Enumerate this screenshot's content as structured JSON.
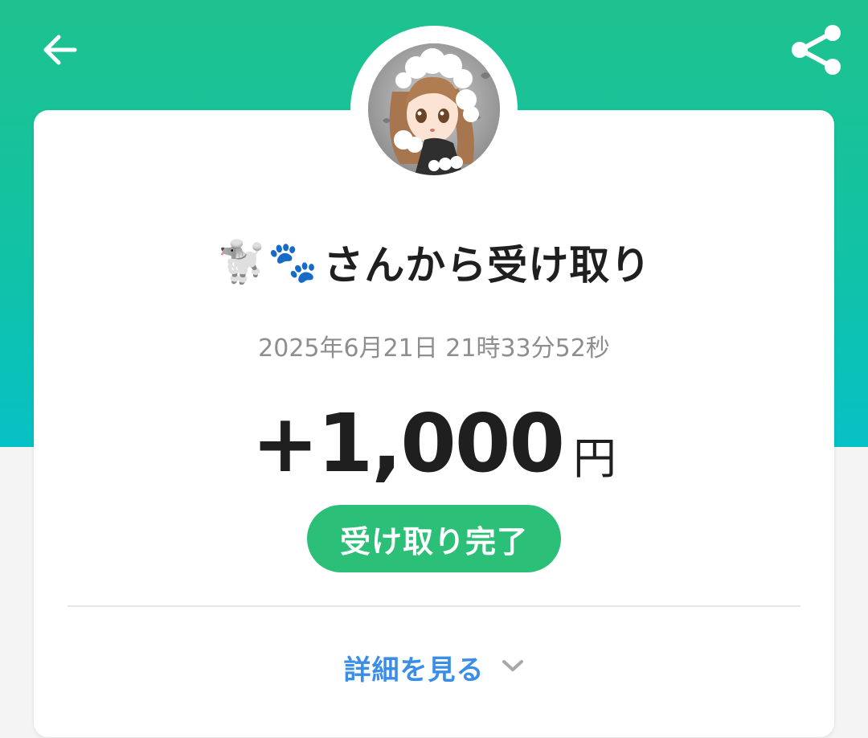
{
  "header": {
    "back_icon": "arrow-left-icon",
    "share_icon": "share-icon",
    "gradient": [
      "#1ec28e",
      "#06c1c6"
    ]
  },
  "sender": {
    "name_emoji": "🐩🐾",
    "title_suffix": "さんから受け取り",
    "avatar": "avatar-image"
  },
  "transaction": {
    "timestamp": "2025年6月21日 21時33分52秒",
    "amount": "+1,000",
    "currency": "円",
    "status": "受け取り完了",
    "status_color": "#2cbf78"
  },
  "details": {
    "label": "詳細を見る",
    "icon": "chevron-down-icon",
    "color": "#3b8ee8"
  }
}
